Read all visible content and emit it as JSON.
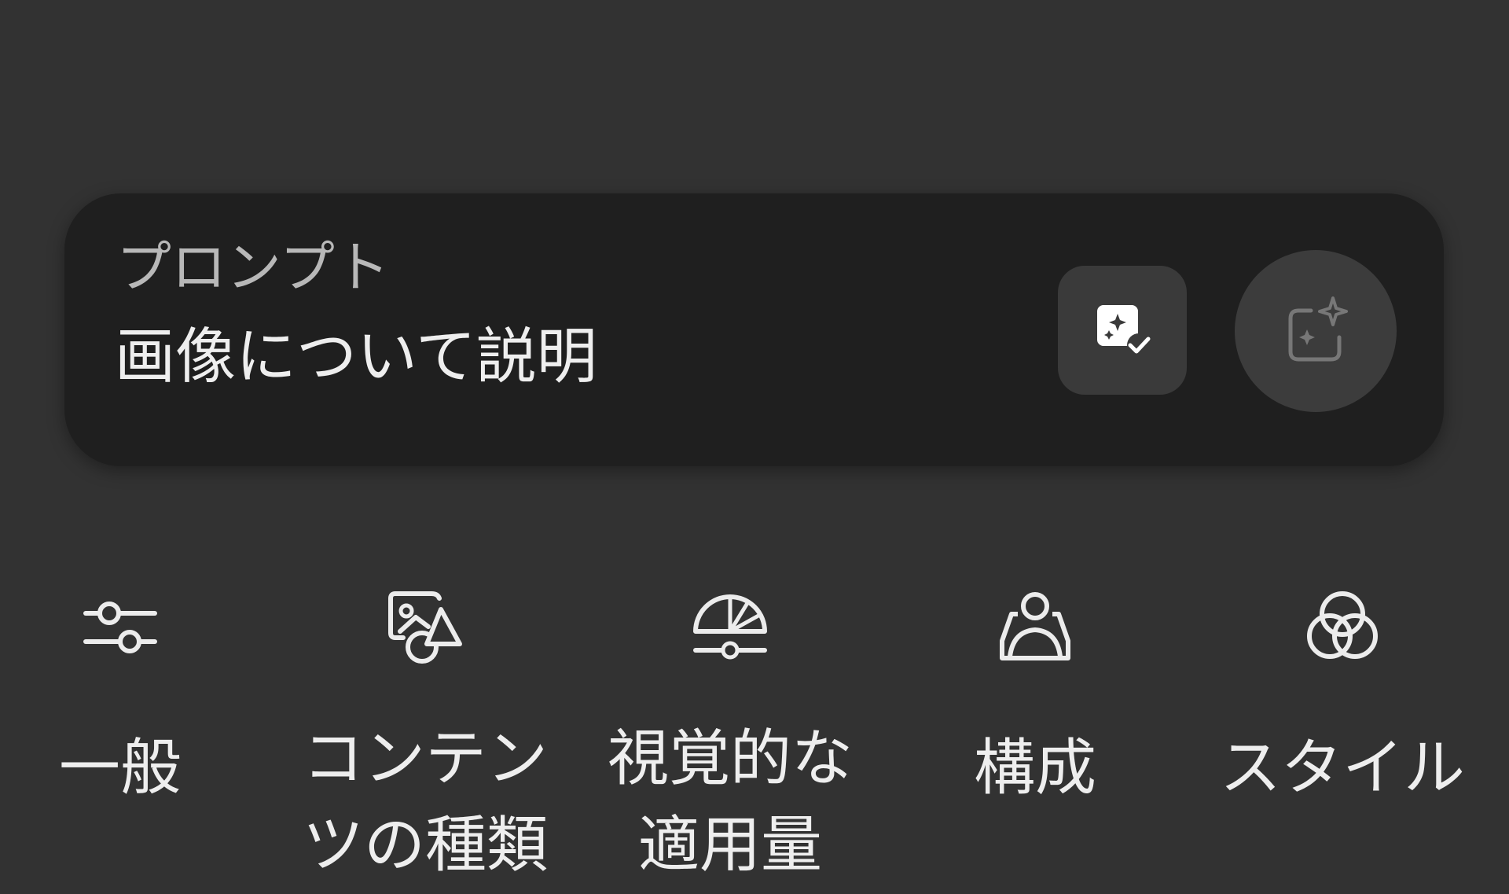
{
  "prompt": {
    "label": "プロンプト",
    "text": "画像について説明"
  },
  "actions": {
    "check_icon": "image-sparkle-check-icon",
    "generate_icon": "image-sparkle-generate-icon"
  },
  "tabs": [
    {
      "label": "一般",
      "icon": "sliders-icon"
    },
    {
      "label": "コンテンツの種類",
      "icon": "content-type-icon"
    },
    {
      "label": "視覚的な適用量",
      "icon": "gauge-icon"
    },
    {
      "label": "構成",
      "icon": "person-frame-icon"
    },
    {
      "label": "スタイル",
      "icon": "overlapping-circles-icon"
    }
  ],
  "colors": {
    "background": "#323232",
    "card": "#1f1f1f",
    "button": "#3a3a3a",
    "text": "#eeeeee",
    "muted_text": "#b8b8b8"
  }
}
